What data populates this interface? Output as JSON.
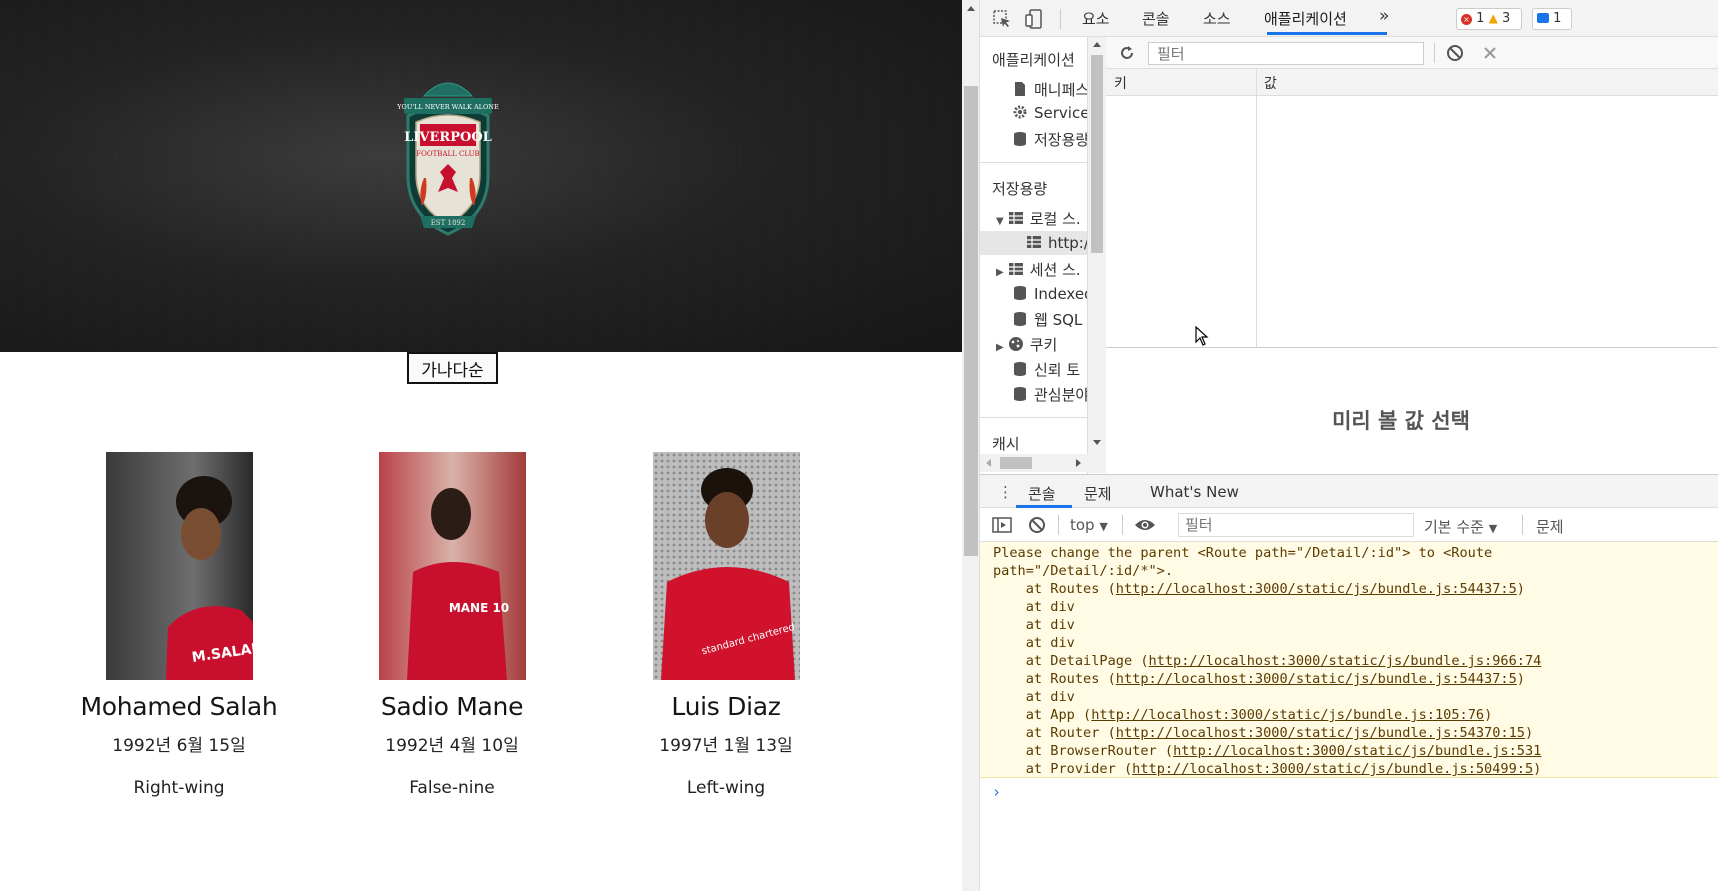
{
  "page": {
    "sort_button": "가나다순",
    "crest": {
      "motto": "YOU'LL NEVER WALK ALONE",
      "club": "LIVERPOOL",
      "subtitle": "FOOTBALL CLUB",
      "est": "EST 1892"
    },
    "players": [
      {
        "name": "Mohamed Salah",
        "dob": "1992년 6월 15일",
        "position": "Right-wing",
        "jersey": "M.SALAH"
      },
      {
        "name": "Sadio Mane",
        "dob": "1992년 4월 10일",
        "position": "False-nine",
        "jersey": "MANE 10"
      },
      {
        "name": "Luis Diaz",
        "dob": "1997년 1월 13일",
        "position": "Left-wing",
        "jersey": "standard chartered"
      }
    ]
  },
  "devtools": {
    "tabs": [
      "요소",
      "콘솔",
      "소스",
      "애플리케이션"
    ],
    "more": "»",
    "errors": "1",
    "warnings": "3",
    "messages": "1",
    "sidebar": {
      "section_app": "애플리케이션",
      "app_items": [
        "매니페스",
        "Service '",
        "저장용량"
      ],
      "section_storage": "저장용량",
      "storage_items": [
        "로컬 스.",
        "http:/",
        "세션 스.",
        "Indexed",
        "웹 SQL",
        "쿠키",
        "신뢰 토",
        "관심분야"
      ],
      "section_cache": "캐시"
    },
    "storage": {
      "filter_placeholder": "필터",
      "col_key": "키",
      "col_value": "값",
      "preview_message": "미리 볼 값 선택"
    },
    "drawer": {
      "tabs": [
        "콘솔",
        "문제",
        "What's New"
      ],
      "context": "top",
      "filter_placeholder": "필터",
      "level": "기본 수준",
      "issues": "문제"
    },
    "console": {
      "lines": [
        {
          "text": "Please change the parent <Route path=\"/Detail/:id\"> to <Route"
        },
        {
          "text": "path=\"/Detail/:id/*\">."
        },
        {
          "prefix": "    at Routes (",
          "link": "http://localhost:3000/static/js/bundle.js:54437:5",
          "suffix": ")"
        },
        {
          "text": "    at div"
        },
        {
          "text": "    at div"
        },
        {
          "text": "    at div"
        },
        {
          "prefix": "    at DetailPage (",
          "link": "http://localhost:3000/static/js/bundle.js:966:74",
          "suffix": ""
        },
        {
          "prefix": "    at Routes (",
          "link": "http://localhost:3000/static/js/bundle.js:54437:5",
          "suffix": ")"
        },
        {
          "text": "    at div"
        },
        {
          "prefix": "    at App (",
          "link": "http://localhost:3000/static/js/bundle.js:105:76",
          "suffix": ")"
        },
        {
          "prefix": "    at Router (",
          "link": "http://localhost:3000/static/js/bundle.js:54370:15",
          "suffix": ")"
        },
        {
          "prefix": "    at BrowserRouter (",
          "link": "http://localhost:3000/static/js/bundle.js:531",
          "suffix": ""
        },
        {
          "prefix": "    at Provider (",
          "link": "http://localhost:3000/static/js/bundle.js:50499:5",
          "suffix": ")"
        }
      ],
      "prompt": "›"
    }
  }
}
